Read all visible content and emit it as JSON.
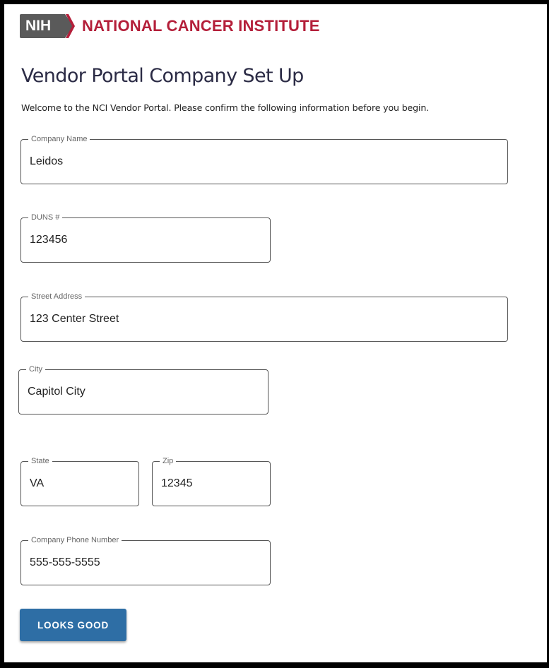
{
  "header": {
    "logo_nih": "NIH",
    "logo_institute": "NATIONAL CANCER INSTITUTE"
  },
  "page": {
    "title": "Vendor Portal Company Set Up",
    "intro": "Welcome to the NCI Vendor Portal. Please confirm the following information before you begin."
  },
  "form": {
    "company_name": {
      "label": "Company Name",
      "value": "Leidos"
    },
    "duns": {
      "label": "DUNS #",
      "value": "123456"
    },
    "street_address": {
      "label": "Street Address",
      "value": "123 Center Street"
    },
    "city": {
      "label": "City",
      "value": "Capitol City"
    },
    "state": {
      "label": "State",
      "value": "VA"
    },
    "zip": {
      "label": "Zip",
      "value": "12345"
    },
    "phone": {
      "label": "Company Phone Number",
      "value": "555-555-5555"
    },
    "submit_label": "LOOKS GOOD"
  },
  "colors": {
    "brand_red": "#b41f3a",
    "nih_gray": "#5a5a5a",
    "button_blue": "#2e6ea5"
  }
}
